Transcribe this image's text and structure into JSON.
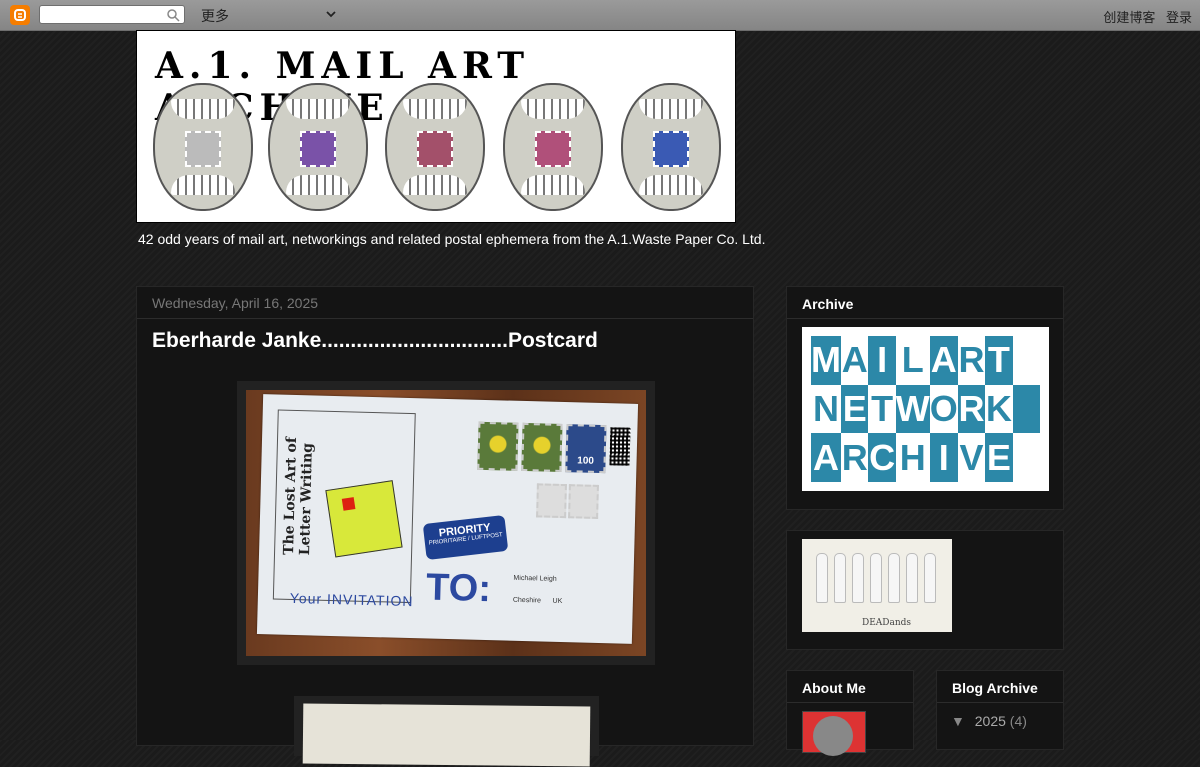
{
  "navbar": {
    "more_label": "更多",
    "create_blog": "创建博客",
    "login": "登录"
  },
  "header": {
    "title": "A.1. MAIL ART ARCHIVE",
    "tagline": "42 odd years of mail art, networkings and related postal ephemera from the A.1.Waste Paper Co. Ltd."
  },
  "post": {
    "date": "Wednesday, April 16, 2025",
    "title": "Eberharde Janke................................Postcard",
    "image1": {
      "vertical_text": "The Lost Art of Letter Writing",
      "priority_label": "PRIORITY",
      "priority_sub": "PRIORITAIRE / LUFTPOST",
      "to_label": "TO:",
      "invitation": "Your INVITATION",
      "address_name": "Michael Leigh",
      "address_place": "Cheshire",
      "address_country": "UK",
      "stamp_value": "100"
    }
  },
  "sidebar": {
    "archive_title": "Archive",
    "archive_grid": [
      "M",
      "A",
      "I",
      "L",
      "A",
      "R",
      "T",
      "",
      "N",
      "E",
      "T",
      "W",
      "O",
      "R",
      "K",
      "",
      "A",
      "R",
      "C",
      "H",
      "I",
      "V",
      "E",
      ""
    ],
    "dead_label": "DEADands",
    "about_title": "About Me",
    "blog_archive_title": "Blog Archive",
    "blog_archive_year": "2025",
    "blog_archive_count": "(4)"
  },
  "colors": {
    "archive_blue": "#2c88a8",
    "navbar_bg": "#8f8f8f",
    "page_bg": "#1b1b1b"
  }
}
